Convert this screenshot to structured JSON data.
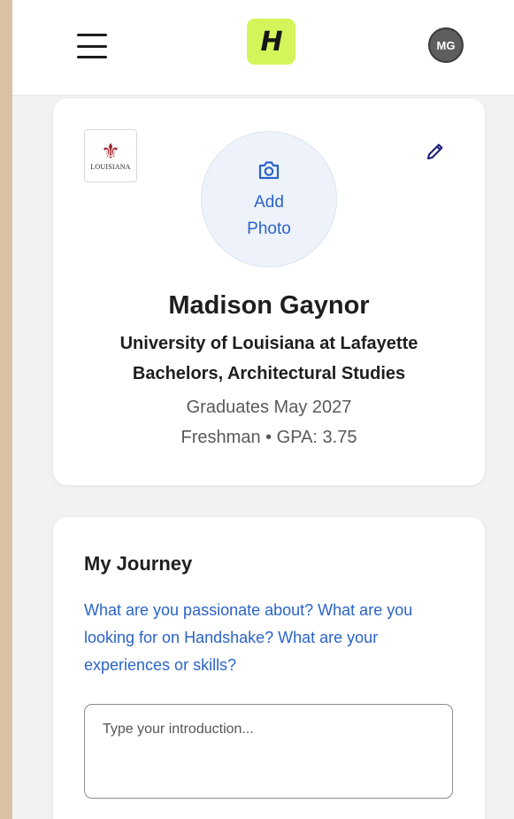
{
  "header": {
    "logo_letter": "H",
    "user_initials": "MG"
  },
  "profile": {
    "school_logo_text": "LOUISIANA",
    "add_photo_label": "Add Photo",
    "name": "Madison Gaynor",
    "school": "University of Louisiana at Lafayette",
    "degree": "Bachelors, Architectural Studies",
    "graduation": "Graduates May 2027",
    "class_year_gpa": "Freshman • GPA: 3.75"
  },
  "journey": {
    "title": "My Journey",
    "prompt": "What are you passionate about? What are you looking for on Handshake? What are your experiences or skills?",
    "introduction_value": "",
    "introduction_placeholder": "Type your introduction..."
  },
  "colors": {
    "page_background": "#dcc0a3",
    "accent_blue": "#2a63c6",
    "logo_green": "#d4f55a",
    "school_red": "#9b1c25"
  },
  "icons": [
    "menu-icon",
    "handshake-logo",
    "camera-icon",
    "pencil-icon",
    "fleur-de-lis-icon"
  ]
}
